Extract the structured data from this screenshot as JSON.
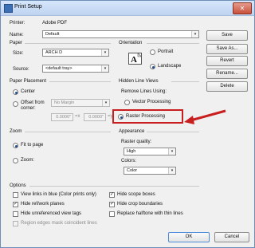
{
  "window": {
    "title": "Print Setup",
    "close_label": "✕"
  },
  "printer": {
    "label": "Printer:",
    "value": "Adobe PDF"
  },
  "name": {
    "label": "Name:",
    "value": "Default"
  },
  "paper": {
    "heading": "Paper",
    "size_label": "Size:",
    "size_value": "ARCH D",
    "source_label": "Source:",
    "source_value": "<default tray>"
  },
  "orientation": {
    "heading": "Orientation",
    "portrait": "Portrait",
    "landscape": "Landscape",
    "selected": "landscape"
  },
  "placement": {
    "heading": "Paper Placement",
    "center": "Center",
    "offset": "Offset from corner:",
    "margin_value": "No Margin",
    "x_value": "0.0000\"",
    "x_sep": "=x",
    "y_value": "0.0000\"",
    "y_sep": "=y"
  },
  "hidden_lines": {
    "heading": "Hidden Line Views",
    "remove_label": "Remove Lines Using:",
    "vector": "Vector Processing",
    "raster": "Raster Processing"
  },
  "zoom": {
    "heading": "Zoom",
    "fit": "Fit to page",
    "zoom_label": "Zoom:"
  },
  "appearance": {
    "heading": "Appearance",
    "quality_label": "Raster quality:",
    "quality_value": "High",
    "colors_label": "Colors:",
    "colors_value": "Color"
  },
  "options": {
    "heading": "Options",
    "items": [
      {
        "label": "View links in blue (Color prints only)",
        "checked": false
      },
      {
        "label": "Hide ref/work planes",
        "checked": true
      },
      {
        "label": "Hide unreferenced view tags",
        "checked": false
      },
      {
        "label": "Region edges mask coincident lines",
        "checked": false,
        "disabled": true
      },
      {
        "label": "Hide scope boxes",
        "checked": true
      },
      {
        "label": "Hide crop boundaries",
        "checked": true
      },
      {
        "label": "Replace halftone with thin lines",
        "checked": false
      }
    ]
  },
  "buttons": {
    "save": "Save",
    "save_as": "Save As...",
    "revert": "Revert",
    "rename": "Rename...",
    "delete": "Delete",
    "ok": "OK",
    "cancel": "Cancel"
  },
  "glyphs": {
    "check": "✓",
    "dropdown": "▾"
  },
  "colors": {
    "highlight": "#c81e1e",
    "accent": "#1d4f91"
  }
}
